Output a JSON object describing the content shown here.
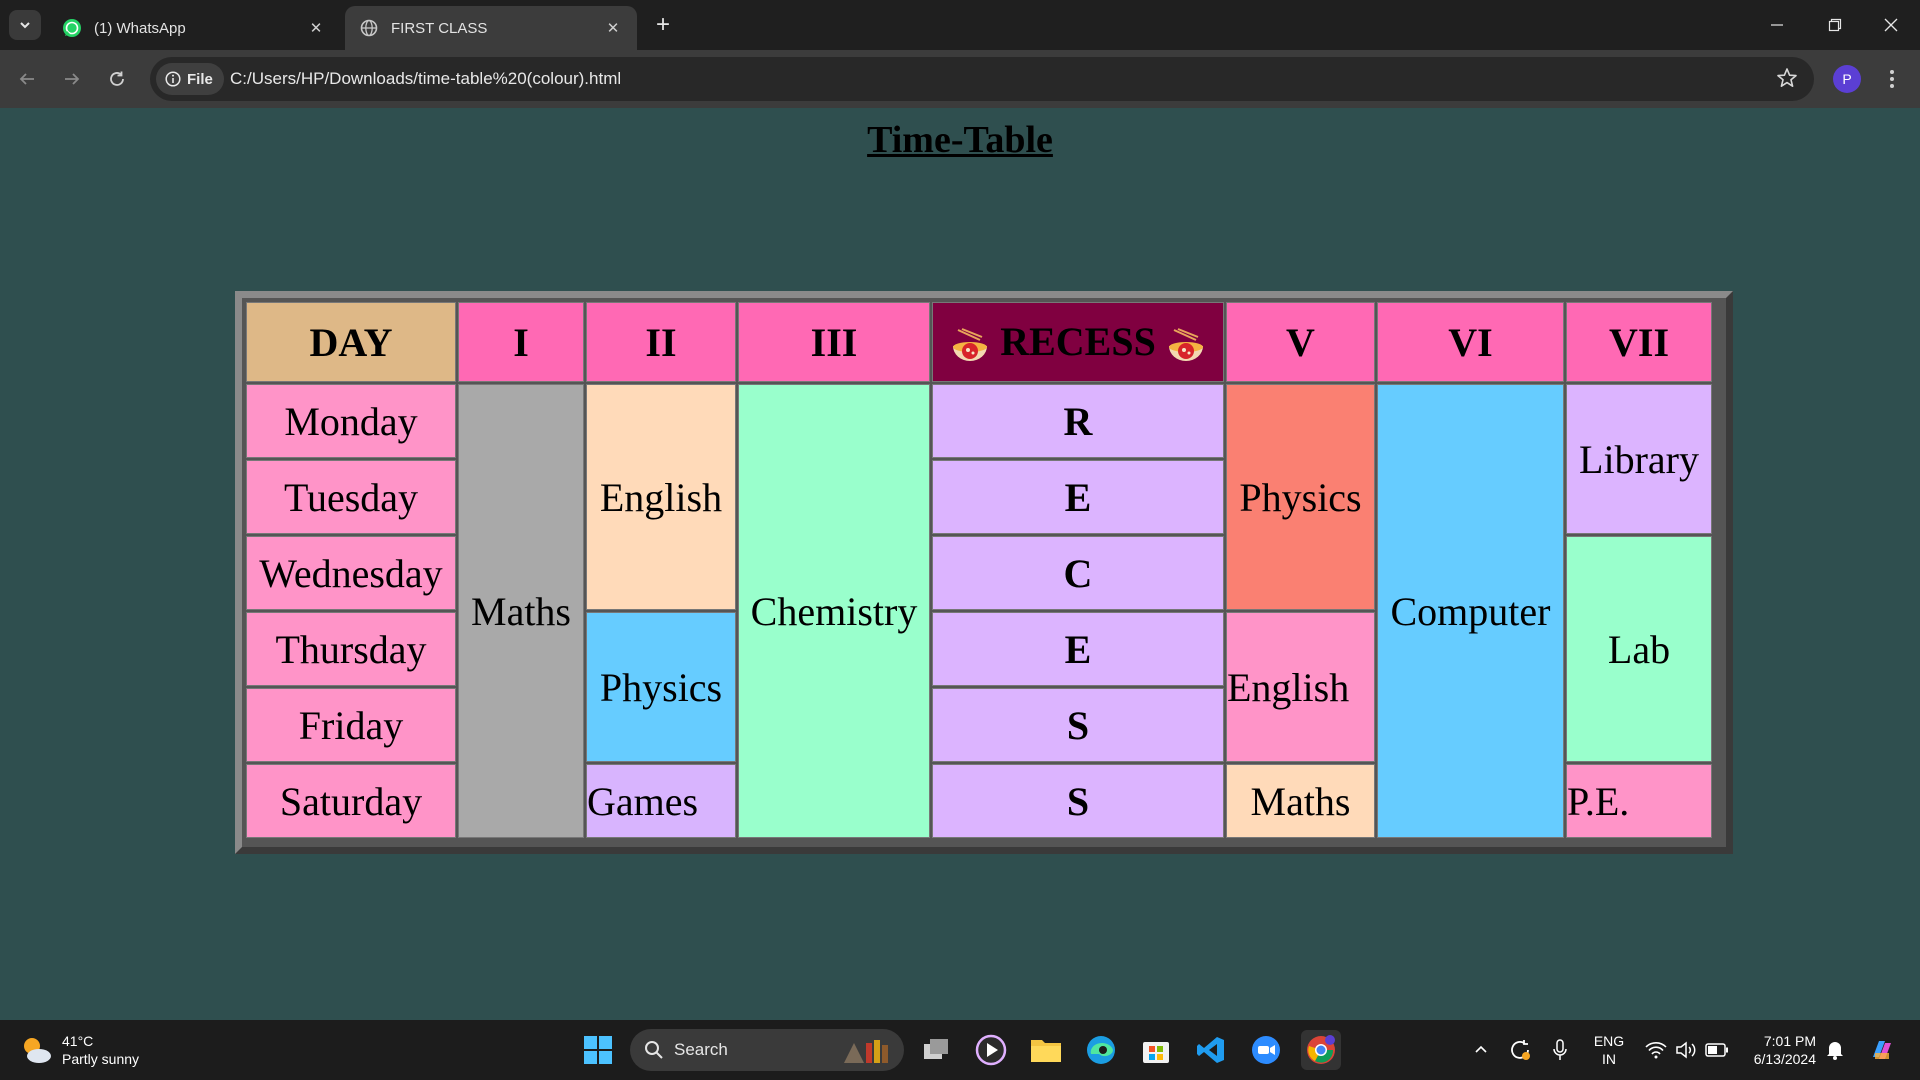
{
  "browser": {
    "tabs": [
      {
        "title": "(1) WhatsApp",
        "icon": "whatsapp-icon",
        "active": false
      },
      {
        "title": "FIRST CLASS",
        "icon": "globe-icon",
        "active": true
      }
    ],
    "chip_label": "File",
    "url": "C:/Users/HP/Downloads/time-table%20(colour).html",
    "profile_initial": "P"
  },
  "page": {
    "title": "Time-Table"
  },
  "timetable": {
    "headers": [
      "DAY",
      "I",
      "II",
      "III",
      "RECESS",
      "V",
      "VI",
      "VII"
    ],
    "days": [
      "Monday",
      "Tuesday",
      "Wednesday",
      "Thursday",
      "Friday",
      "Saturday"
    ],
    "recess_letters": [
      "R",
      "E",
      "C",
      "E",
      "S",
      "S"
    ],
    "period1": "Maths",
    "period2": {
      "english": "English",
      "physics": "Physics",
      "games": "Games"
    },
    "period3": "Chemistry",
    "period5": {
      "physics": "Physics",
      "english": "English",
      "maths": "Maths"
    },
    "period6": "Computer",
    "period7": {
      "library": "Library",
      "lab": "Lab",
      "pe": "P.E."
    },
    "colors": {
      "header": "#ff69b4",
      "day_header": "#deb887",
      "recess_header": "#800040",
      "day_cell": "#ff94c8",
      "maths": "#a9a9a9",
      "english": "#ffdab9",
      "physics": "#66ccff",
      "chemistry": "#99ffcc",
      "recess_cell": "#dcb4ff",
      "physics_v": "#fa8072"
    }
  },
  "taskbar": {
    "weather_temp": "41°C",
    "weather_desc": "Partly sunny",
    "search_label": "Search",
    "lang_line1": "ENG",
    "lang_line2": "IN",
    "time": "7:01 PM",
    "date": "6/13/2024"
  }
}
